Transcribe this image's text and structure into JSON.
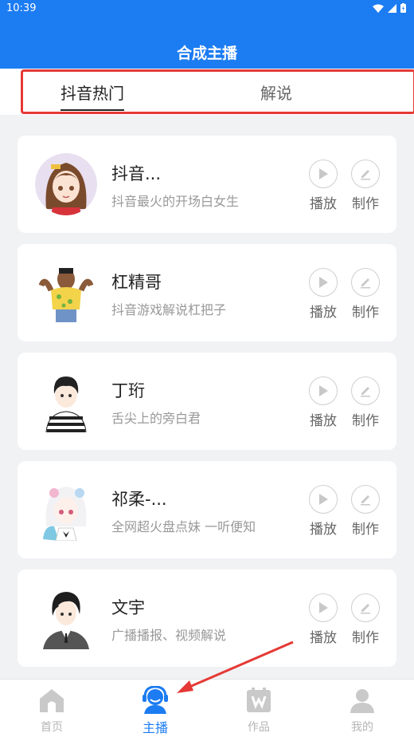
{
  "status_bar": {
    "time": "10:39"
  },
  "header": {
    "title": "合成主播"
  },
  "tabs": [
    {
      "label": "抖音热门",
      "active": true
    },
    {
      "label": "解说",
      "active": false
    }
  ],
  "anchors": [
    {
      "name": "抖音...",
      "desc": "抖音最火的开场白女生",
      "avatar": "girl-avatar"
    },
    {
      "name": "杠精哥",
      "desc": "抖音游戏解说杠把子",
      "avatar": "muscle-man-avatar"
    },
    {
      "name": "丁珩",
      "desc": "舌尖上的旁白君",
      "avatar": "boy-avatar"
    },
    {
      "name": "祁柔-...",
      "desc": "全网超火盘点妹 一听便知",
      "avatar": "white-hair-girl-avatar"
    },
    {
      "name": "文宇",
      "desc": "广播播报、视频解说",
      "avatar": "suit-man-avatar"
    }
  ],
  "actions": {
    "play": "播放",
    "make": "制作"
  },
  "bottom_nav": [
    {
      "label": "首页",
      "icon": "home-icon",
      "active": false
    },
    {
      "label": "主播",
      "icon": "headset-person-icon",
      "active": true
    },
    {
      "label": "作品",
      "icon": "works-box-icon",
      "active": false
    },
    {
      "label": "我的",
      "icon": "person-icon",
      "active": false
    }
  ],
  "colors": {
    "primary": "#1c7cf2",
    "annotation": "#e53935"
  }
}
